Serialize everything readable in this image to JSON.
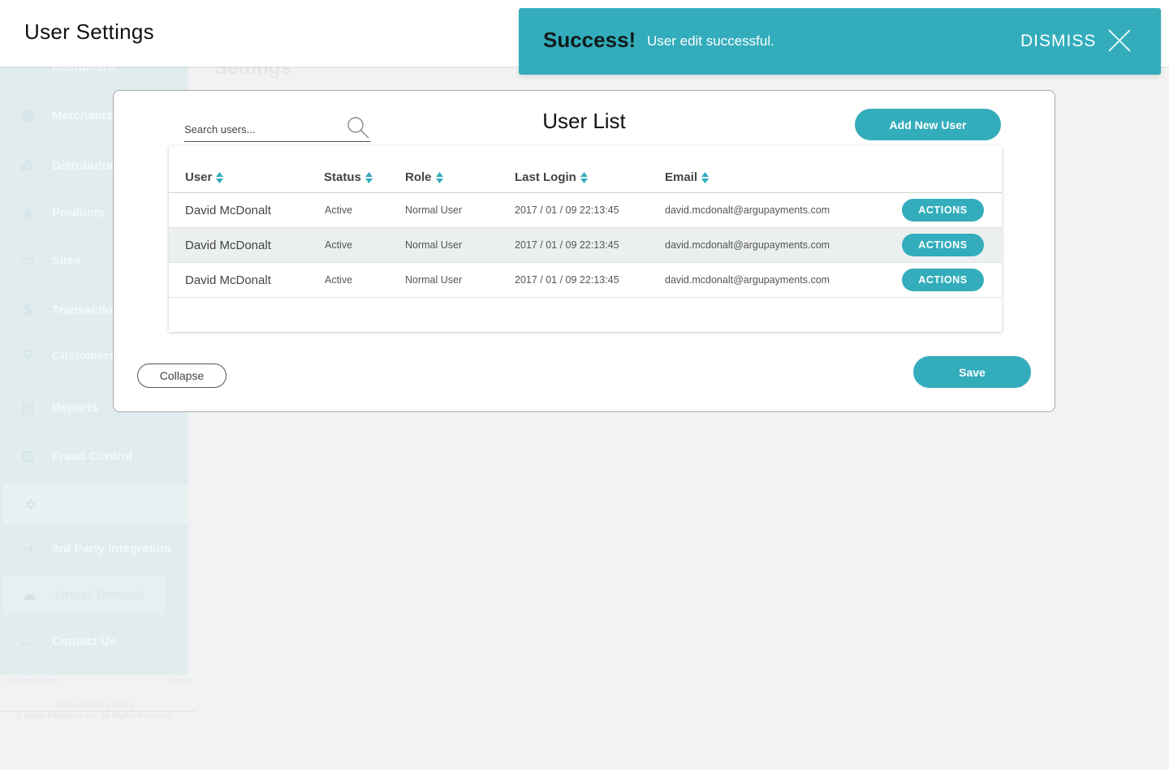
{
  "header": {
    "title": "User Settings"
  },
  "background": {
    "page_title": "Settings",
    "sidebar": {
      "items": [
        {
          "label": "Dashboard",
          "icon": "dashboard-icon"
        },
        {
          "label": "Merchants",
          "icon": "store-icon"
        },
        {
          "label": "Distributors",
          "icon": "network-icon"
        },
        {
          "label": "Products",
          "icon": "tag-icon"
        },
        {
          "label": "Sites",
          "icon": "site-icon"
        },
        {
          "label": "Transactions",
          "icon": "dollar-icon"
        },
        {
          "label": "Customers",
          "icon": "person-icon"
        },
        {
          "label": "Reports",
          "icon": "document-icon"
        },
        {
          "label": "Fraud Control",
          "icon": "lock-icon"
        },
        {
          "label": "Settings",
          "icon": "gear-icon"
        },
        {
          "label": "3rd Party Integration",
          "icon": "integration-icon"
        },
        {
          "label": "Virtual Terminal",
          "icon": "terminal-icon"
        },
        {
          "label": "Contact Us",
          "icon": "chat-icon"
        }
      ],
      "collapse_label": "Collapse Menu",
      "logout_label": "Logout",
      "footer_links": "Terms | Privacy Policy",
      "copyright": "© Argus Payments Inc. All Rights Reserved"
    }
  },
  "toast": {
    "title": "Success!",
    "message": "User edit successful.",
    "dismiss_label": "DISMISS",
    "color": "#33adbc"
  },
  "panel": {
    "title": "User List",
    "search": {
      "placeholder": "Search users..."
    },
    "add_user_label": "Add New User",
    "collapse_label": "Collapse",
    "save_label": "Save",
    "table": {
      "columns": [
        "User",
        "Status",
        "Role",
        "Last Login",
        "Email"
      ],
      "rows": [
        {
          "user": "David McDonalt",
          "status": "Active",
          "role": "Normal User",
          "last_login": "2017 / 01 / 09 22:13:45",
          "email": "david.mcdonalt@argupayments.com",
          "action": "ACTIONS"
        },
        {
          "user": "David McDonalt",
          "status": "Active",
          "role": "Normal User",
          "last_login": "2017 / 01 / 09 22:13:45",
          "email": "david.mcdonalt@argupayments.com",
          "action": "ACTIONS"
        },
        {
          "user": "David McDonalt",
          "status": "Active",
          "role": "Normal User",
          "last_login": "2017 / 01 / 09 22:13:45",
          "email": "david.mcdonalt@argupayments.com",
          "action": "ACTIONS"
        }
      ]
    }
  },
  "colors": {
    "accent": "#33adbc",
    "background": "#f2f2f2"
  }
}
